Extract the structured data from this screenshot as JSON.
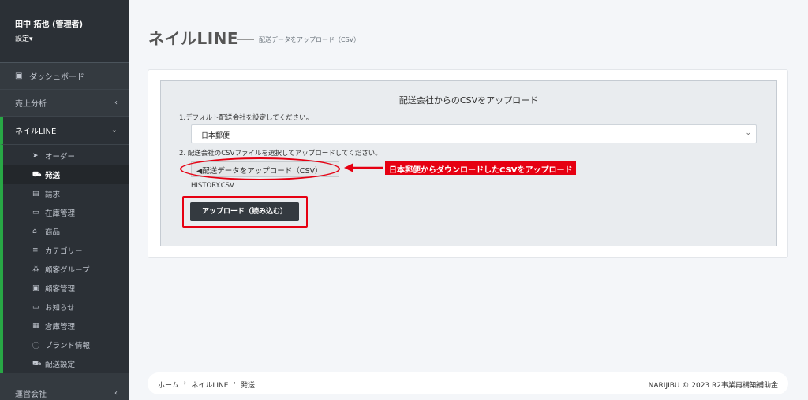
{
  "user": {
    "name": "田中 拓也 (管理者)",
    "settings": "設定▾"
  },
  "nav": {
    "dashboard": "ダッシュボード",
    "sales": "売上分析",
    "nail_line": "ネイルLINE",
    "company": "運営会社"
  },
  "submenu": [
    {
      "icon": "send-icon",
      "glyph": "➤",
      "label": "オーダー"
    },
    {
      "icon": "truck-icon",
      "glyph": "⛟",
      "label": "発送",
      "current": true
    },
    {
      "icon": "invoice-icon",
      "glyph": "▤",
      "label": "請求"
    },
    {
      "icon": "monitor-icon",
      "glyph": "▭",
      "label": "在庫管理"
    },
    {
      "icon": "store-icon",
      "glyph": "⌂",
      "label": "商品"
    },
    {
      "icon": "list-icon",
      "glyph": "≡",
      "label": "カテゴリー"
    },
    {
      "icon": "sitemap-icon",
      "glyph": "⁂",
      "label": "顧客グループ"
    },
    {
      "icon": "address-book-icon",
      "glyph": "▣",
      "label": "顧客管理"
    },
    {
      "icon": "monitor-icon",
      "glyph": "▭",
      "label": "お知らせ"
    },
    {
      "icon": "warehouse-icon",
      "glyph": "▦",
      "label": "倉庫管理"
    },
    {
      "icon": "info-icon",
      "glyph": "ⓘ",
      "label": "ブランド情報"
    },
    {
      "icon": "truck-icon",
      "glyph": "⛟",
      "label": "配送設定"
    }
  ],
  "header": {
    "title": "ネイルLINE",
    "subtitle": "配送データをアップロード（CSV）"
  },
  "panel": {
    "title": "配送会社からのCSVをアップロード",
    "step1": "1.デフォルト配送会社を設定してください。",
    "carrier_value": "日本郵便",
    "step2": "2. 配送会社のCSVファイルを選択してアップロードしてください。",
    "file_button": "◀配送データをアップロード（CSV）",
    "filename": "HISTORY.CSV",
    "upload_button": "アップロード（読み込む）"
  },
  "annotation": {
    "callout": "日本郵便からダウンロードしたCSVをアップロード",
    "color": "#e60012"
  },
  "footer": {
    "breadcrumb": [
      "ホーム",
      "ネイルLINE",
      "発送"
    ],
    "separator": "›",
    "copyright": "NARIJIBU © 2023 R2事業再構築補助金"
  }
}
